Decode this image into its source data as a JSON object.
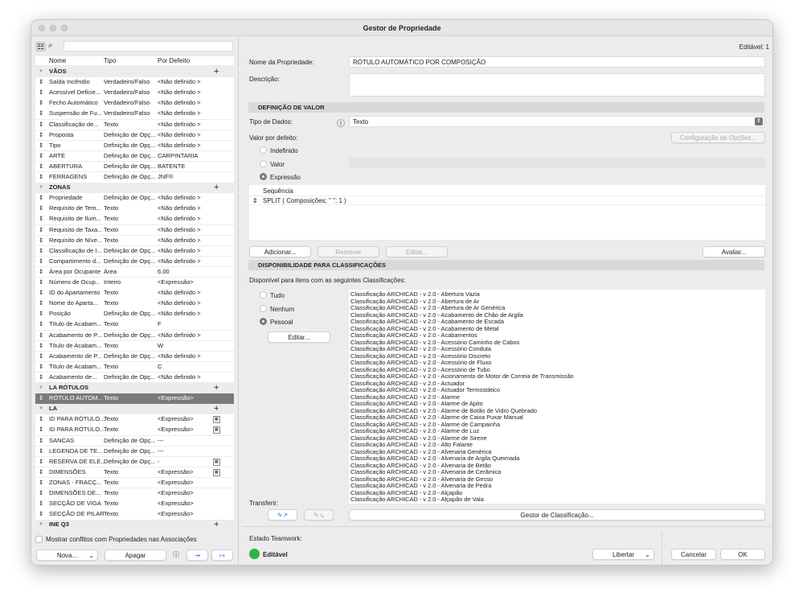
{
  "window": {
    "title": "Gestor de Propriedade"
  },
  "left": {
    "columns": [
      "Nome",
      "Tipo",
      "Por Defeito"
    ],
    "groups": [
      {
        "name": "VÃOS",
        "rows": [
          [
            "Saída Incêndio",
            "Verdadeiro/Falso",
            "<Não definido >"
          ],
          [
            "Acessível Deficie...",
            "Verdadeiro/Falso",
            "<Não definido >"
          ],
          [
            "Fecho Automático",
            "Verdadeiro/Falso",
            "<Não definido >"
          ],
          [
            "Suspensão de Fu...",
            "Verdadeiro/Falso",
            "<Não definido >"
          ],
          [
            "Classificação de...",
            "Texto",
            "<Não definido >"
          ],
          [
            "Proposta",
            "Definição de Opç...",
            "<Não definido >"
          ],
          [
            "Tipo",
            "Definição de Opç...",
            "<Não definido >"
          ],
          [
            "ARTE",
            "Definição de Opç...",
            "CARPINTARIA"
          ],
          [
            "ABERTURA",
            "Definição de Opç...",
            "BATENTE"
          ],
          [
            "FERRAGENS",
            "Definição de Opç...",
            "JNF®"
          ]
        ]
      },
      {
        "name": "ZONAS",
        "rows": [
          [
            "Propriedade",
            "Definição de Opç...",
            "<Não definido >"
          ],
          [
            "Requisito de Tem...",
            "Texto",
            "<Não definido >"
          ],
          [
            "Requisito de Ilum...",
            "Texto",
            "<Não definido >"
          ],
          [
            "Requisito de Taxa...",
            "Texto",
            "<Não definido >"
          ],
          [
            "Requisito de Níve...",
            "Texto",
            "<Não definido >"
          ],
          [
            "Classificação de I...",
            "Definição de Opç...",
            "<Não definido >"
          ],
          [
            "Compartimento d...",
            "Definição de Opç...",
            "<Não definido >"
          ],
          [
            "Área por Ocupante",
            "Área",
            "6,00"
          ],
          [
            "Número de Ocup...",
            "Inteiro",
            "<Expressão>"
          ],
          [
            "ID do Apartamento",
            "Texto",
            "<Não definido >"
          ],
          [
            "Nome do Aparta...",
            "Texto",
            "<Não definido >"
          ],
          [
            "Posição",
            "Definição de Opç...",
            "<Não definido >"
          ],
          [
            "Título de Acabam...",
            "Texto",
            "F"
          ],
          [
            "Acabamento de P...",
            "Definição de Opç...",
            "<Não definido >"
          ],
          [
            "Título de Acabam...",
            "Texto",
            "W"
          ],
          [
            "Acabamento de P...",
            "Definição de Opç...",
            "<Não definido >"
          ],
          [
            "Título de Acabam...",
            "Texto",
            "C"
          ],
          [
            "Acabamento de...",
            "Definição de Opç...",
            "<Não definido >"
          ]
        ]
      },
      {
        "name": "LA RÓTULOS",
        "rows": [
          [
            "RÓTULO AUTOM...",
            "Texto",
            "<Expressão>"
          ]
        ]
      },
      {
        "name": "LA",
        "rows": [
          [
            "ID PARA RÓTULO...",
            "Texto",
            "<Expressão>"
          ],
          [
            "ID PARA RÓTULO...",
            "Texto",
            "<Expressão>"
          ],
          [
            "SANCAS",
            "Definição de Opç...",
            "---"
          ],
          [
            "LEGENDA DE TE...",
            "Definição de Opç...",
            "---"
          ],
          [
            "RESERVA DE ELE...",
            "Definição de Opç...",
            "-"
          ],
          [
            "DIMENSÕES",
            "Texto",
            "<Expressão>"
          ],
          [
            "ZONAS - FRACÇ...",
            "Texto",
            "<Expressão>"
          ],
          [
            "DIMENSÕES DE...",
            "Texto",
            "<Expressão>"
          ],
          [
            "SECÇÃO DE VIGA",
            "Texto",
            "<Expressão>"
          ],
          [
            "SECÇÃO DE PILAR",
            "Texto",
            "<Expressão>"
          ]
        ]
      },
      {
        "name": "INE Q3",
        "rows": []
      }
    ],
    "selected_row": "RÓTULO AUTOM...",
    "show_conflicts_label": "Mostrar conflitos com Propriedades nas Associações",
    "new_button": "Nova...",
    "delete_button": "Apagar"
  },
  "right": {
    "editable_count": "Editável: 1",
    "name_label": "Nome da Propriedade:",
    "name_value": "RÓTULO AUTOMÁTICO POR COMPOSIÇÃO",
    "description_label": "Descrição:",
    "value_def_header": "DEFINIÇÃO DE VALOR",
    "data_type_label": "Tipo de Dados:",
    "data_type_value": "Texto",
    "default_value_label": "Valor por defeito:",
    "options_config_button": "Configuração de Opções...",
    "radio_undefined": "Indefinido",
    "radio_value": "Valor",
    "radio_expression": "Expressão",
    "sequence_header": "Sequência",
    "expression": "SPLIT ( Composições; \" \"; 1 )",
    "add_button": "Adicionar...",
    "remove_button": "Remover",
    "edit_button": "Editar...",
    "evaluate_button": "Avaliar...",
    "availability_header": "DISPONIBILIDADE PARA CLASSIFICAÇÕES",
    "availability_text": "Disponível para itens com as seguintes Classificações:",
    "radio_all": "Tudo",
    "radio_none": "Nenhum",
    "radio_custom": "Pessoal",
    "edit_class_button": "Editar...",
    "classifications": [
      "Classificação ARCHICAD - v 2.0 - Abertura Vazia",
      "Classificação ARCHICAD - v 2.0 - Abertura de Ar",
      "Classificação ARCHICAD - v 2.0 - Abertura de Ar Genérica",
      "Classificação ARCHICAD - v 2.0 - Acabamento de Chão de Argila",
      "Classificação ARCHICAD - v 2.0 - Acabamento de Escada",
      "Classificação ARCHICAD - v 2.0 - Acabamento de Metal",
      "Classificação ARCHICAD - v 2.0 - Acabamentos",
      "Classificação ARCHICAD - v 2.0 - Acessório Caminho de Cabos",
      "Classificação ARCHICAD - v 2.0 - Acessório Conduta",
      "Classificação ARCHICAD - v 2.0 - Acessório Discreto",
      "Classificação ARCHICAD - v 2.0 - Acessório de Fluxo",
      "Classificação ARCHICAD - v 2.0 - Acessório de Tubo",
      "Classificação ARCHICAD - v 2.0 - Acionamento de Motor de Correia de Transmissão",
      "Classificação ARCHICAD - v 2.0 - Actuador",
      "Classificação ARCHICAD - v 2.0 - Actuador Termostático",
      "Classificação ARCHICAD - v 2.0 - Alarme",
      "Classificação ARCHICAD - v 2.0 - Alarme de Apito",
      "Classificação ARCHICAD - v 2.0 - Alarme de Botão de Vidro Quebrado",
      "Classificação ARCHICAD - v 2.0 - Alarme de Caixa Puxar Manual",
      "Classificação ARCHICAD - v 2.0 - Alarme de Campainha",
      "Classificação ARCHICAD - v 2.0 - Alarme de Luz",
      "Classificação ARCHICAD - v 2.0 - Alarme de Sirene",
      "Classificação ARCHICAD - v 2.0 - Alto Falante",
      "Classificação ARCHICAD - v 2.0 - Alvenaria Genérica",
      "Classificação ARCHICAD - v 2.0 - Alvenaria de Argila Queimada",
      "Classificação ARCHICAD - v 2.0 - Alvenaria de Betão",
      "Classificação ARCHICAD - v 2.0 - Alvenaria de Cerâmica",
      "Classificação ARCHICAD - v 2.0 - Alvenaria de Gesso",
      "Classificação ARCHICAD - v 2.0 - Alvenaria de Pedra",
      "Classificação ARCHICAD - v 2.0 - Alçapão",
      "Classificação ARCHICAD - v 2.0 - Alçapão de Vala"
    ],
    "transfer_label": "Transferir:",
    "class_manager_button": "Gestor de Classificação...",
    "teamwork_label": "Estado Teamwork:",
    "teamwork_status": "Editável",
    "teamwork_color": "#2fb344",
    "release_button": "Libertar",
    "cancel_button": "Cancelar",
    "ok_button": "OK"
  }
}
